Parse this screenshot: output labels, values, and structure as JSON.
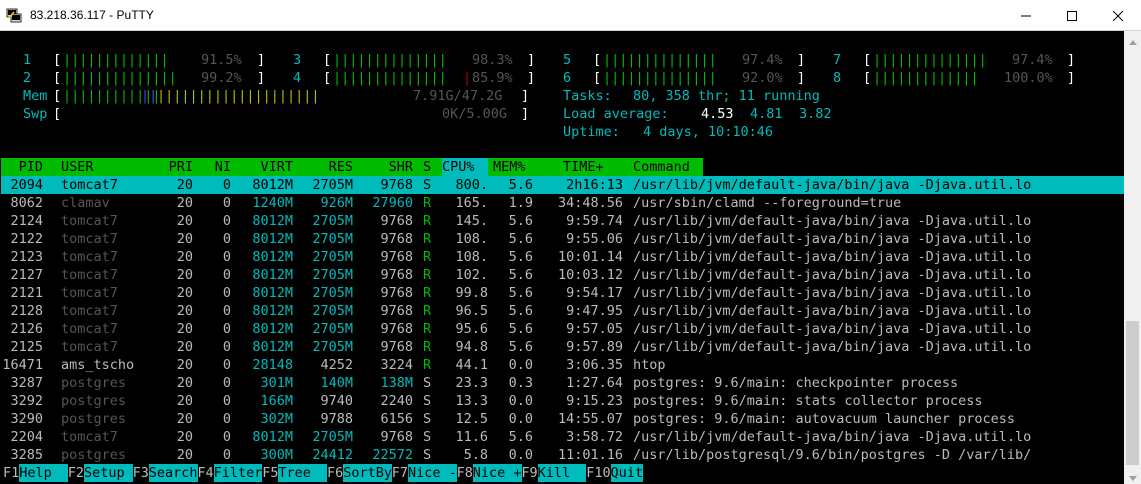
{
  "window": {
    "title": "83.218.36.117 - PuTTY"
  },
  "cpu_meters": [
    {
      "num": "1",
      "bar_green": "|||||||||||||",
      "bar_red": "",
      "pct": "91.5%"
    },
    {
      "num": "2",
      "bar_green": "||||||||||||||",
      "bar_red": "",
      "pct": "99.2%"
    },
    {
      "num": "3",
      "bar_green": "||||||||||||||",
      "bar_red": "",
      "pct": "98.3%"
    },
    {
      "num": "4",
      "bar_green": "||||||||||||||",
      "bar_red": "",
      "pct": "85.9%"
    },
    {
      "num": "5",
      "bar_green": "||||||||||||||",
      "bar_red": "",
      "pct": "97.4%"
    },
    {
      "num": "6",
      "bar_green": "||||||||||||||",
      "bar_red": "",
      "pct": "92.0%"
    },
    {
      "num": "7",
      "bar_green": "||||||||||||||",
      "bar_red": "",
      "pct": "97.4%"
    },
    {
      "num": "8",
      "bar_green": "|||||||||||||",
      "bar_red": "",
      "pct": "100.0%"
    }
  ],
  "mem": {
    "label": "Mem",
    "bar_green": "||||||||||||",
    "bar_blue": "||",
    "bar_yellow": "||||||||||||||||||||",
    "value": "7.91G/47.2G"
  },
  "swp": {
    "label": "Swp",
    "value": "0K/5.00G"
  },
  "tasks": {
    "label": "Tasks:",
    "value": "80, 358 thr; 11 running"
  },
  "load": {
    "label": "Load average:",
    "v1": "4.53",
    "v2": "4.81",
    "v3": "3.82"
  },
  "uptime": {
    "label": "Uptime:",
    "value": "4 days, 10:10:46"
  },
  "columns": {
    "pid": "PID",
    "user": "USER",
    "pri": "PRI",
    "ni": "NI",
    "virt": "VIRT",
    "res": "RES",
    "shr": "SHR",
    "s": "S",
    "cpu": "CPU%",
    "mem": "MEM%",
    "time": "TIME+",
    "command": "Command"
  },
  "processes": [
    {
      "pid": "2094",
      "user": "tomcat7",
      "pri": "20",
      "ni": "0",
      "virt": "8012M",
      "res": "2705M",
      "shr": "9768",
      "s": "S",
      "cpu": "800.",
      "mem": "5.6",
      "time": "2h16:13",
      "command": "/usr/lib/jvm/default-java/bin/java -Djava.util.lo"
    },
    {
      "pid": "8062",
      "user": "clamav",
      "pri": "20",
      "ni": "0",
      "virt": "1240M",
      "res": "926M",
      "shr": "27960",
      "s": "R",
      "cpu": "165.",
      "mem": "1.9",
      "time": "34:48.56",
      "command": "/usr/sbin/clamd --foreground=true"
    },
    {
      "pid": "2124",
      "user": "tomcat7",
      "pri": "20",
      "ni": "0",
      "virt": "8012M",
      "res": "2705M",
      "shr": "9768",
      "s": "R",
      "cpu": "145.",
      "mem": "5.6",
      "time": "9:59.74",
      "command": "/usr/lib/jvm/default-java/bin/java -Djava.util.lo"
    },
    {
      "pid": "2122",
      "user": "tomcat7",
      "pri": "20",
      "ni": "0",
      "virt": "8012M",
      "res": "2705M",
      "shr": "9768",
      "s": "R",
      "cpu": "108.",
      "mem": "5.6",
      "time": "9:55.06",
      "command": "/usr/lib/jvm/default-java/bin/java -Djava.util.lo"
    },
    {
      "pid": "2123",
      "user": "tomcat7",
      "pri": "20",
      "ni": "0",
      "virt": "8012M",
      "res": "2705M",
      "shr": "9768",
      "s": "R",
      "cpu": "108.",
      "mem": "5.6",
      "time": "10:01.14",
      "command": "/usr/lib/jvm/default-java/bin/java -Djava.util.lo"
    },
    {
      "pid": "2127",
      "user": "tomcat7",
      "pri": "20",
      "ni": "0",
      "virt": "8012M",
      "res": "2705M",
      "shr": "9768",
      "s": "R",
      "cpu": "102.",
      "mem": "5.6",
      "time": "10:03.12",
      "command": "/usr/lib/jvm/default-java/bin/java -Djava.util.lo"
    },
    {
      "pid": "2121",
      "user": "tomcat7",
      "pri": "20",
      "ni": "0",
      "virt": "8012M",
      "res": "2705M",
      "shr": "9768",
      "s": "R",
      "cpu": "99.8",
      "mem": "5.6",
      "time": "9:54.17",
      "command": "/usr/lib/jvm/default-java/bin/java -Djava.util.lo"
    },
    {
      "pid": "2128",
      "user": "tomcat7",
      "pri": "20",
      "ni": "0",
      "virt": "8012M",
      "res": "2705M",
      "shr": "9768",
      "s": "R",
      "cpu": "96.5",
      "mem": "5.6",
      "time": "9:47.95",
      "command": "/usr/lib/jvm/default-java/bin/java -Djava.util.lo"
    },
    {
      "pid": "2126",
      "user": "tomcat7",
      "pri": "20",
      "ni": "0",
      "virt": "8012M",
      "res": "2705M",
      "shr": "9768",
      "s": "R",
      "cpu": "95.6",
      "mem": "5.6",
      "time": "9:57.05",
      "command": "/usr/lib/jvm/default-java/bin/java -Djava.util.lo"
    },
    {
      "pid": "2125",
      "user": "tomcat7",
      "pri": "20",
      "ni": "0",
      "virt": "8012M",
      "res": "2705M",
      "shr": "9768",
      "s": "R",
      "cpu": "94.8",
      "mem": "5.6",
      "time": "9:57.89",
      "command": "/usr/lib/jvm/default-java/bin/java -Djava.util.lo"
    },
    {
      "pid": "16471",
      "user": "ams_tscho",
      "pri": "20",
      "ni": "0",
      "virt": "28148",
      "res": "4252",
      "shr": "3224",
      "s": "R",
      "cpu": "44.1",
      "mem": "0.0",
      "time": "3:06.35",
      "command": "htop"
    },
    {
      "pid": "3287",
      "user": "postgres",
      "pri": "20",
      "ni": "0",
      "virt": "301M",
      "res": "140M",
      "shr": "138M",
      "s": "S",
      "cpu": "23.3",
      "mem": "0.3",
      "time": "1:27.64",
      "command": "postgres: 9.6/main: checkpointer process"
    },
    {
      "pid": "3292",
      "user": "postgres",
      "pri": "20",
      "ni": "0",
      "virt": "166M",
      "res": "9740",
      "shr": "2240",
      "s": "S",
      "cpu": "13.3",
      "mem": "0.0",
      "time": "9:15.23",
      "command": "postgres: 9.6/main: stats collector process"
    },
    {
      "pid": "3290",
      "user": "postgres",
      "pri": "20",
      "ni": "0",
      "virt": "302M",
      "res": "9788",
      "shr": "6156",
      "s": "S",
      "cpu": "12.5",
      "mem": "0.0",
      "time": "14:55.07",
      "command": "postgres: 9.6/main: autovacuum launcher process"
    },
    {
      "pid": "2204",
      "user": "tomcat7",
      "pri": "20",
      "ni": "0",
      "virt": "8012M",
      "res": "2705M",
      "shr": "9768",
      "s": "S",
      "cpu": "11.6",
      "mem": "5.6",
      "time": "3:58.72",
      "command": "/usr/lib/jvm/default-java/bin/java -Djava.util.lo"
    },
    {
      "pid": "3285",
      "user": "postgres",
      "pri": "20",
      "ni": "0",
      "virt": "300M",
      "res": "24412",
      "shr": "22572",
      "s": "S",
      "cpu": "5.8",
      "mem": "0.0",
      "time": "11:01.16",
      "command": "/usr/lib/postgresql/9.6/bin/postgres -D /var/lib/"
    }
  ],
  "footer": [
    {
      "key": "F1",
      "label": "Help  "
    },
    {
      "key": "F2",
      "label": "Setup "
    },
    {
      "key": "F3",
      "label": "Search"
    },
    {
      "key": "F4",
      "label": "Filter"
    },
    {
      "key": "F5",
      "label": "Tree  "
    },
    {
      "key": "F6",
      "label": "SortBy"
    },
    {
      "key": "F7",
      "label": "Nice -"
    },
    {
      "key": "F8",
      "label": "Nice +"
    },
    {
      "key": "F9",
      "label": "Kill  "
    },
    {
      "key": "F10",
      "label": "Quit"
    }
  ],
  "colors": {
    "terminal_bg": "#000000",
    "header_green": "#00bb00",
    "selection_cyan": "#00bbbb",
    "text_gray": "#bbbbbb",
    "dim_gray": "#555555",
    "running_green": "#00bb00"
  },
  "icons": {
    "app": "putty-icon",
    "minimize": "minimize-icon",
    "maximize": "maximize-icon",
    "close": "close-icon"
  }
}
